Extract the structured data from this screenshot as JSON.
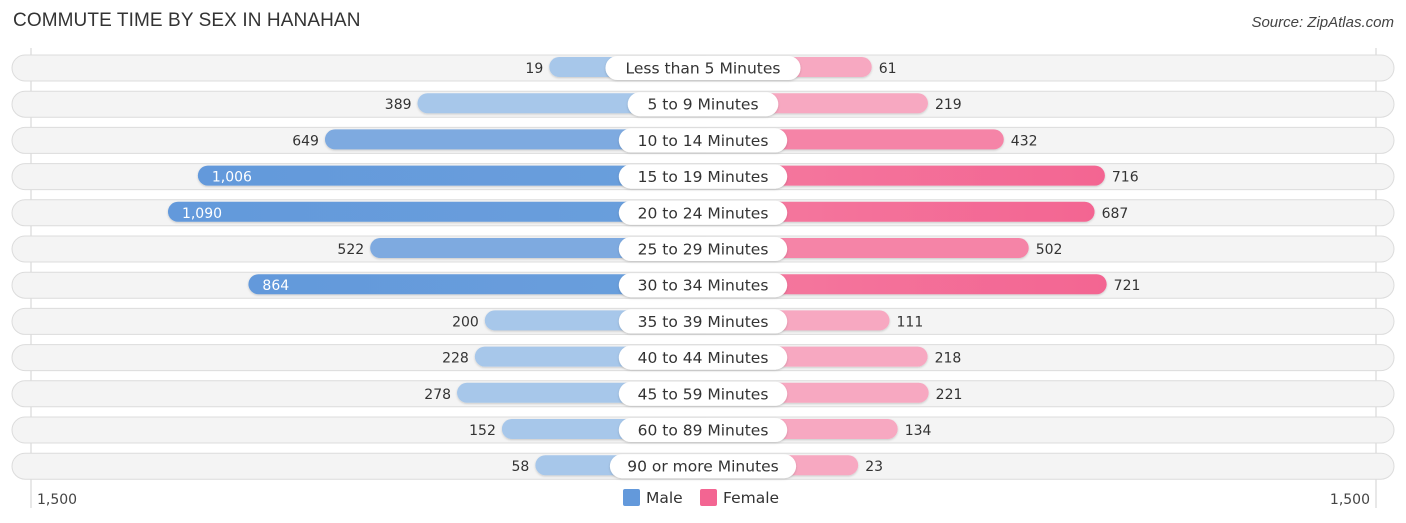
{
  "header": {
    "title": "COMMUTE TIME BY SEX IN HANAHAN",
    "source": "Source: ZipAtlas.com"
  },
  "chart_data": {
    "type": "bar",
    "orientation": "horizontal-diverging",
    "title": "COMMUTE TIME BY SEX IN HANAHAN",
    "categories": [
      "Less than 5 Minutes",
      "5 to 9 Minutes",
      "10 to 14 Minutes",
      "15 to 19 Minutes",
      "20 to 24 Minutes",
      "25 to 29 Minutes",
      "30 to 34 Minutes",
      "35 to 39 Minutes",
      "40 to 44 Minutes",
      "45 to 59 Minutes",
      "60 to 89 Minutes",
      "90 or more Minutes"
    ],
    "series": [
      {
        "name": "Male",
        "side": "left",
        "color": "#6399db",
        "light_color": "#a7c7ea",
        "values": [
          19,
          389,
          649,
          1006,
          1090,
          522,
          864,
          200,
          228,
          278,
          152,
          58
        ],
        "labels": [
          "19",
          "389",
          "649",
          "1,006",
          "1,090",
          "522",
          "864",
          "200",
          "228",
          "278",
          "152",
          "58"
        ]
      },
      {
        "name": "Female",
        "side": "right",
        "color": "#f36592",
        "light_color": "#f7a8c1",
        "values": [
          61,
          219,
          432,
          716,
          687,
          502,
          721,
          111,
          218,
          221,
          134,
          23
        ],
        "labels": [
          "61",
          "219",
          "432",
          "716",
          "687",
          "502",
          "721",
          "111",
          "218",
          "221",
          "134",
          "23"
        ]
      }
    ],
    "axis": {
      "min_label": "1,500",
      "max_label": "1,500",
      "range": [
        -1500,
        1500
      ]
    },
    "legend": {
      "position": "bottom-center",
      "items": [
        "Male",
        "Female"
      ]
    },
    "grid": false
  }
}
